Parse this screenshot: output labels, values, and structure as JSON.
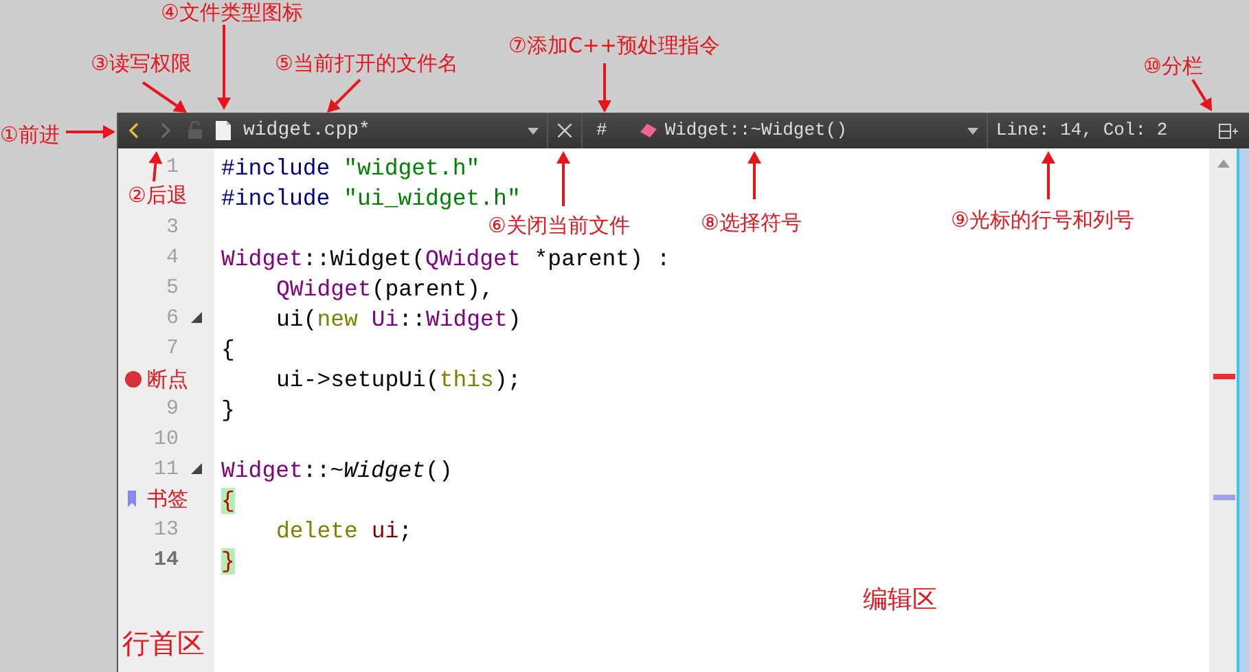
{
  "toolbar": {
    "back": {
      "disabled": false
    },
    "forward": {
      "disabled": true
    },
    "file_name": "widget.cpp*",
    "preprocessor_button": "#",
    "symbol": "Widget::~Widget()",
    "cursor_position": "Line: 14, Col: 2"
  },
  "lines": [
    {
      "number": "1",
      "tokens": [
        {
          "text": "#include ",
          "kind": "preproc"
        },
        {
          "text": "\"widget.h\"",
          "kind": "string"
        }
      ]
    },
    {
      "tokens": [
        {
          "text": "#include ",
          "kind": "preproc"
        },
        {
          "text": "\"ui_widget.h\"",
          "kind": "string"
        }
      ]
    },
    {
      "number": "3"
    },
    {
      "number": "4",
      "tokens": [
        {
          "text": "Widget",
          "kind": "type"
        },
        {
          "text": "::Widget(",
          "kind": "plain"
        },
        {
          "text": "QWidget",
          "kind": "type"
        },
        {
          "text": " *parent) :",
          "kind": "plain"
        }
      ]
    },
    {
      "number": "5",
      "indent": true,
      "tokens": [
        {
          "text": "QWidget",
          "kind": "type"
        },
        {
          "text": "(parent),",
          "kind": "plain"
        }
      ]
    },
    {
      "number": "6",
      "fold": true,
      "indent": true,
      "tokens": [
        {
          "text": "ui(",
          "kind": "plain"
        },
        {
          "text": "new ",
          "kind": "keyword"
        },
        {
          "text": "Ui",
          "kind": "type"
        },
        {
          "text": "::",
          "kind": "plain"
        },
        {
          "text": "Widget",
          "kind": "type"
        },
        {
          "text": ")",
          "kind": "plain"
        }
      ]
    },
    {
      "number": "7",
      "tokens": [
        {
          "text": "{",
          "kind": "plain"
        }
      ]
    },
    {
      "breakpoint": true,
      "indent": true,
      "tokens": [
        {
          "text": "ui->setupUi(",
          "kind": "plain"
        },
        {
          "text": "this",
          "kind": "keyword"
        },
        {
          "text": ");",
          "kind": "plain"
        }
      ]
    },
    {
      "number": "9",
      "tokens": [
        {
          "text": "}",
          "kind": "plain"
        }
      ]
    },
    {
      "number": "10"
    },
    {
      "number": "11",
      "fold": true,
      "tokens": [
        {
          "text": "Widget",
          "kind": "type"
        },
        {
          "text": "::~",
          "kind": "plain"
        },
        {
          "text": "Widget",
          "kind": "italic"
        },
        {
          "text": "()",
          "kind": "plain"
        }
      ]
    },
    {
      "bookmark": true,
      "tokens": [
        {
          "text": "{",
          "kind": "brace"
        }
      ]
    },
    {
      "number": "13",
      "indent": true,
      "tokens": [
        {
          "text": "delete ",
          "kind": "keyword"
        },
        {
          "text": "ui",
          "kind": "member"
        },
        {
          "text": ";",
          "kind": "plain"
        }
      ]
    },
    {
      "number": "14",
      "current": true,
      "tokens": [
        {
          "text": "}",
          "kind": "brace"
        }
      ]
    }
  ],
  "annotations": [
    {
      "text": "④文件类型图标"
    },
    {
      "text": "⑦添加C++预处理指令"
    },
    {
      "text": "③读写权限"
    },
    {
      "text": "⑤当前打开的文件名"
    },
    {
      "text": "⑩分栏"
    },
    {
      "text": "①前进"
    },
    {
      "text": "②后退"
    },
    {
      "text": "⑥关闭当前文件"
    },
    {
      "text": "⑧选择符号"
    },
    {
      "text": "⑨光标的行号和列号"
    },
    {
      "text": "断点"
    },
    {
      "text": "书签"
    },
    {
      "text": "编辑区"
    },
    {
      "text": "行首区"
    }
  ]
}
